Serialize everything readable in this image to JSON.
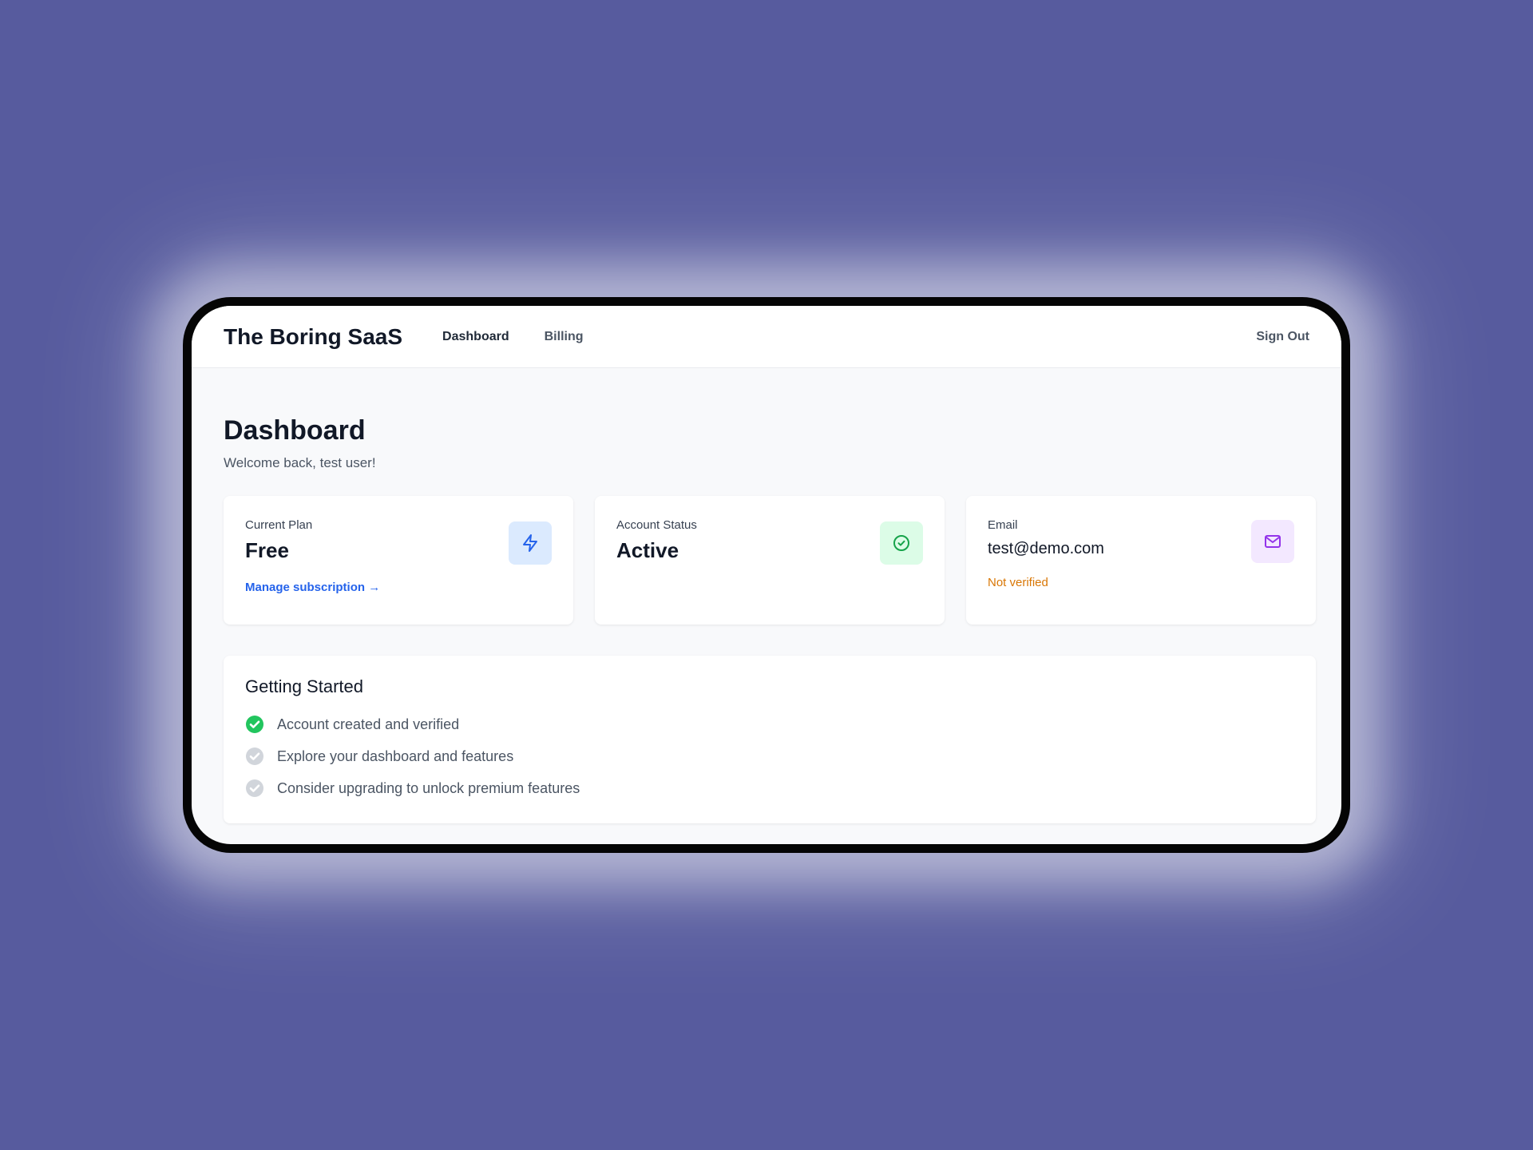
{
  "navbar": {
    "brand": "The Boring SaaS",
    "links": [
      {
        "label": "Dashboard"
      },
      {
        "label": "Billing"
      }
    ],
    "signout": "Sign Out"
  },
  "main": {
    "title": "Dashboard",
    "subtitle": "Welcome back, test user!"
  },
  "cards": {
    "plan": {
      "label": "Current Plan",
      "value": "Free",
      "link": "Manage subscription →",
      "icon": "lightning-icon"
    },
    "status": {
      "label": "Account Status",
      "value": "Active",
      "icon": "check-circle-icon"
    },
    "email": {
      "label": "Email",
      "value": "test@demo.com",
      "note": "Not verified",
      "icon": "mail-icon"
    }
  },
  "getting_started": {
    "title": "Getting Started",
    "items": [
      {
        "text": "Account created and verified",
        "done": true
      },
      {
        "text": "Explore your dashboard and features",
        "done": false
      },
      {
        "text": "Consider upgrading to unlock premium features",
        "done": false
      }
    ]
  },
  "colors": {
    "background": "#575b9e",
    "link": "#2563eb",
    "warning": "#d97706",
    "success": "#22c55e",
    "pending": "#d1d5db"
  }
}
